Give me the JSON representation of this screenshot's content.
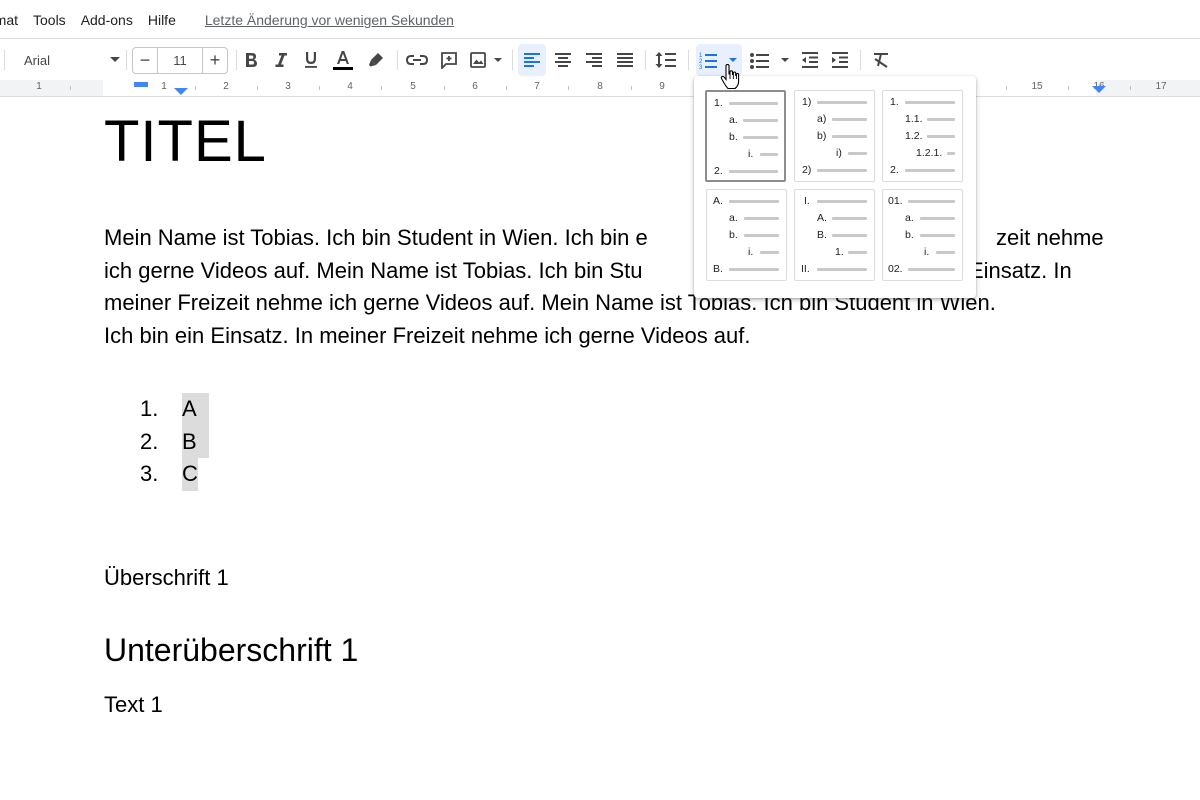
{
  "menu": {
    "items": [
      "rmat",
      "Tools",
      "Add-ons",
      "Hilfe"
    ],
    "last_edit": "Letzte Änderung vor wenigen Sekunden"
  },
  "toolbar": {
    "font": "Arial",
    "font_size": "11",
    "minus": "−",
    "plus": "+",
    "active_color": "#1a73e8",
    "icons": [
      "bold-icon",
      "italic-icon",
      "underline-icon",
      "text-color-icon",
      "highlight-icon",
      "link-icon",
      "comment-icon",
      "image-icon",
      "align-left-icon",
      "align-center-icon",
      "align-right-icon",
      "justify-icon",
      "line-spacing-icon",
      "numbered-list-icon",
      "bulleted-list-icon",
      "decrease-indent-icon",
      "increase-indent-icon",
      "clear-format-icon"
    ]
  },
  "ruler": {
    "numbers": [
      "1",
      "1",
      "2",
      "3",
      "4",
      "5",
      "6",
      "7",
      "8",
      "9",
      "15",
      "16",
      "17"
    ]
  },
  "document": {
    "title": "TITEL",
    "paragraph_lines": [
      "Mein Name ist Tobias. Ich bin Student in Wien. Ich bin e",
      "ich gerne Videos auf. Mein Name ist Tobias. Ich bin Stu",
      "meiner Freizeit nehme ich gerne Videos auf. Mein Name ist Tobias. Ich bin Student in Wien.",
      "Ich bin ein Einsatz. In meiner Freizeit nehme ich gerne Videos auf."
    ],
    "paragraph_tails": [
      "zeit nehme",
      "Einsatz. In"
    ],
    "list": [
      {
        "num": "1.",
        "text": "A"
      },
      {
        "num": "2.",
        "text": "B"
      },
      {
        "num": "3.",
        "text": "C"
      }
    ],
    "heading1": "Überschrift 1",
    "subheading": "Unterüberschrift 1",
    "text1": "Text 1"
  },
  "numbering_presets": [
    {
      "labels": [
        "1.",
        "a.",
        "b.",
        "i.",
        "2."
      ]
    },
    {
      "labels": [
        "1)",
        "a)",
        "b)",
        "i)",
        "2)"
      ]
    },
    {
      "labels": [
        "1.",
        "1.1.",
        "1.2.",
        "1.2.1.",
        "2."
      ]
    },
    {
      "labels": [
        "A.",
        "a.",
        "b.",
        "i.",
        "B."
      ]
    },
    {
      "labels": [
        "I.",
        "A.",
        "B.",
        "1.",
        "II."
      ]
    },
    {
      "labels": [
        "01.",
        "a.",
        "b.",
        "i.",
        "02."
      ]
    }
  ]
}
